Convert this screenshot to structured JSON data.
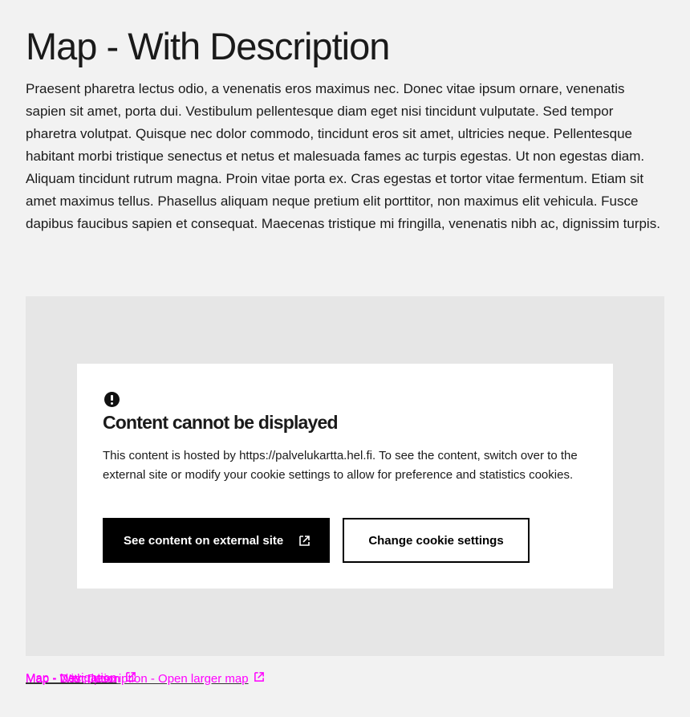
{
  "page": {
    "title": "Map - With Description",
    "description": "Praesent pharetra lectus odio, a venenatis eros maximus nec. Donec vitae ipsum ornare, venenatis sapien sit amet, porta dui. Vestibulum pellentesque diam eget nisi tincidunt vulputate. Sed tempor pharetra volutpat. Quisque nec dolor commodo, tincidunt eros sit amet, ultricies neque. Pellentesque habitant morbi tristique senectus et netus et malesuada fames ac turpis egestas. Ut non egestas diam. Aliquam tincidunt rutrum magna. Proin vitae porta ex. Cras egestas et tortor vitae fermentum. Etiam sit amet maximus tellus. Phasellus aliquam neque pretium elit porttitor, non maximus elit vehicula. Fusce dapibus faucibus sapien et consequat. Maecenas tristique mi fringilla, venenatis nibh ac, dignissim turpis."
  },
  "map": {
    "notice": {
      "icon": "alert-circle-icon",
      "title": "Content cannot be displayed",
      "text": "This content is hosted by https://palvelukartta.hel.fi. To see the content, switch over to the external site or modify your cookie settings to allow for preference and statistics cookies.",
      "primary_button": "See content on external site",
      "secondary_button": "Change cookie settings"
    }
  },
  "links": {
    "navigation": "Map - Navigation",
    "description": "Map - Description",
    "open_larger": "Map - With Description - Open larger map"
  },
  "colors": {
    "background": "#f2f2f2",
    "map_placeholder": "#e6e6e6",
    "link_overlay": "#ff00ff",
    "button_primary": "#000000"
  }
}
